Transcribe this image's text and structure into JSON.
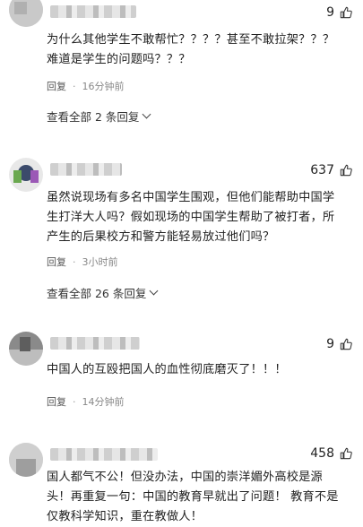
{
  "comments": [
    {
      "likes": "9",
      "text": "为什么其他学生不敢帮忙？？？？甚至不敢拉架？？？难道是学生的问题吗？？？",
      "reply_label": "回复",
      "separator": "·",
      "time": "16分钟前",
      "more_replies": "查看全部 2 条回复"
    },
    {
      "likes": "637",
      "text": "虽然说现场有多名中国学生围观，但他们能帮助中国学生打洋大人吗？假如现场的中国学生帮助了被打者，所产生的后果校方和警方能轻易放过他们吗？",
      "reply_label": "回复",
      "separator": "·",
      "time": "3小时前",
      "more_replies": "查看全部 26 条回复"
    },
    {
      "likes": "9",
      "text": "中国人的互殴把国人的血性彻底磨灭了！！！",
      "reply_label": "回复",
      "separator": "·",
      "time": "14分钟前"
    },
    {
      "likes": "458",
      "text": "国人都气不公！但没办法，中国的崇洋媚外高校是源头！再重复一句：中国的教育早就出了问题！ 教育不是仅教科学知识，重在教做人！"
    }
  ],
  "colors": {
    "text": "#222222",
    "meta": "#888888",
    "background": "#ffffff"
  },
  "icons": [
    "thumbs-up-icon",
    "chevron-down-icon"
  ]
}
